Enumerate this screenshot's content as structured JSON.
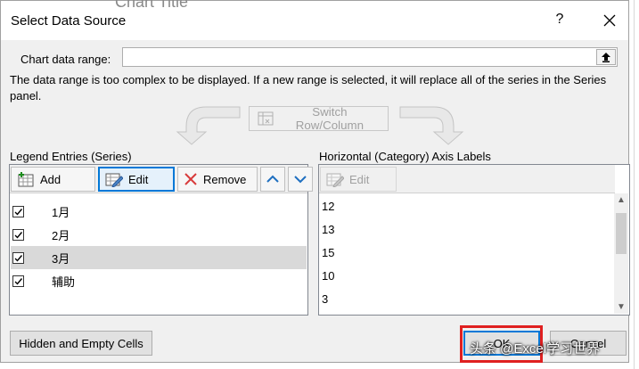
{
  "background": {
    "chart_title": "Chart Title"
  },
  "dialog": {
    "title": "Select Data Source",
    "help": "?",
    "chart_range_label": "Chart data range:",
    "chart_range_value": "",
    "info": "The data range is too complex to be displayed. If a new range is selected, it will replace all of the series in the Series panel.",
    "switch_button": "Switch Row/Column"
  },
  "legend": {
    "label": "Legend Entries (Series)",
    "add": "Add",
    "edit": "Edit",
    "remove": "Remove",
    "series": [
      {
        "name": "1月",
        "checked": true
      },
      {
        "name": "2月",
        "checked": true
      },
      {
        "name": "3月",
        "checked": true,
        "selected": true
      },
      {
        "name": "辅助",
        "checked": true
      }
    ]
  },
  "axis": {
    "label": "Horizontal (Category) Axis Labels",
    "edit": "Edit",
    "values": [
      "12",
      "13",
      "15",
      "10",
      "3"
    ]
  },
  "footer": {
    "hidden_cells": "Hidden and Empty Cells",
    "ok": "OK",
    "cancel": "Cancel",
    "watermark": "头条 @Excel学习世界"
  },
  "colors": {
    "accent": "#0078d7",
    "highlight": "#e02020",
    "selected_row": "#d9d9d9"
  }
}
